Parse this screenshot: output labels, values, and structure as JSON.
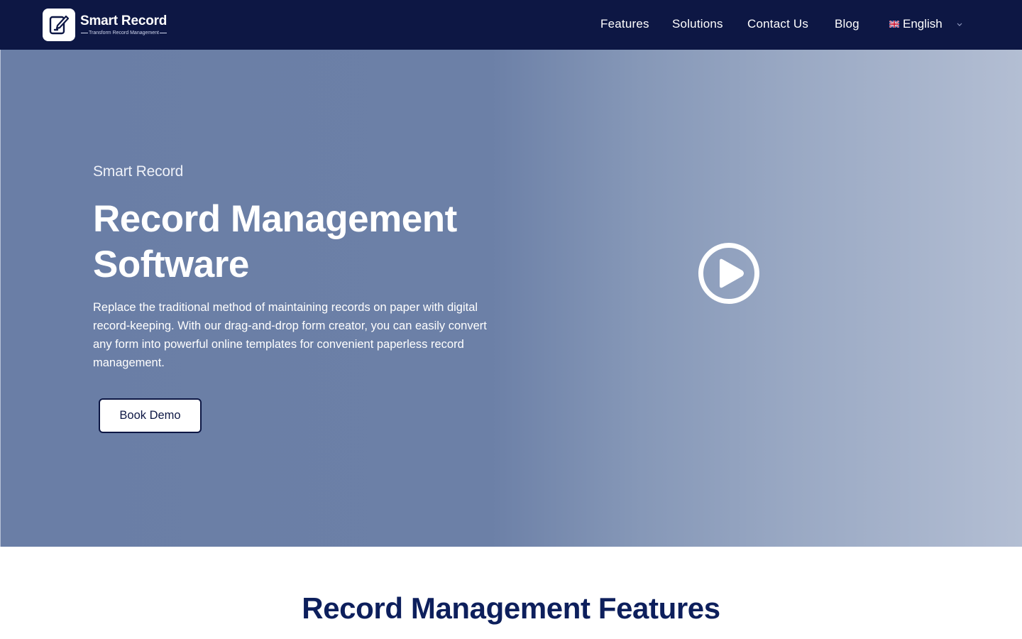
{
  "header": {
    "logo_title": "Smart Record",
    "logo_tagline": "Transform Record Management",
    "nav": [
      {
        "label": "Features"
      },
      {
        "label": "Solutions"
      },
      {
        "label": "Contact Us"
      },
      {
        "label": "Blog"
      }
    ],
    "language": {
      "label": "English",
      "flag_icon": "uk-flag-icon"
    }
  },
  "hero": {
    "eyebrow": "Smart Record",
    "title_line1": "Record Management",
    "title_line2": "Software",
    "description": "Replace the traditional method of maintaining records on paper with digital record-keeping. With our drag-and-drop form creator, you can easily convert any form into powerful online templates for convenient paperless record management.",
    "cta_label": "Book Demo",
    "play_icon": "play-circle-icon"
  },
  "features": {
    "title": "Record Management Features"
  },
  "colors": {
    "header_bg": "#0d1744",
    "hero_left": "#6a7ea6",
    "hero_right": "#b3bed3",
    "heading_navy": "#0d1f5c",
    "button_border": "#0d1744"
  }
}
